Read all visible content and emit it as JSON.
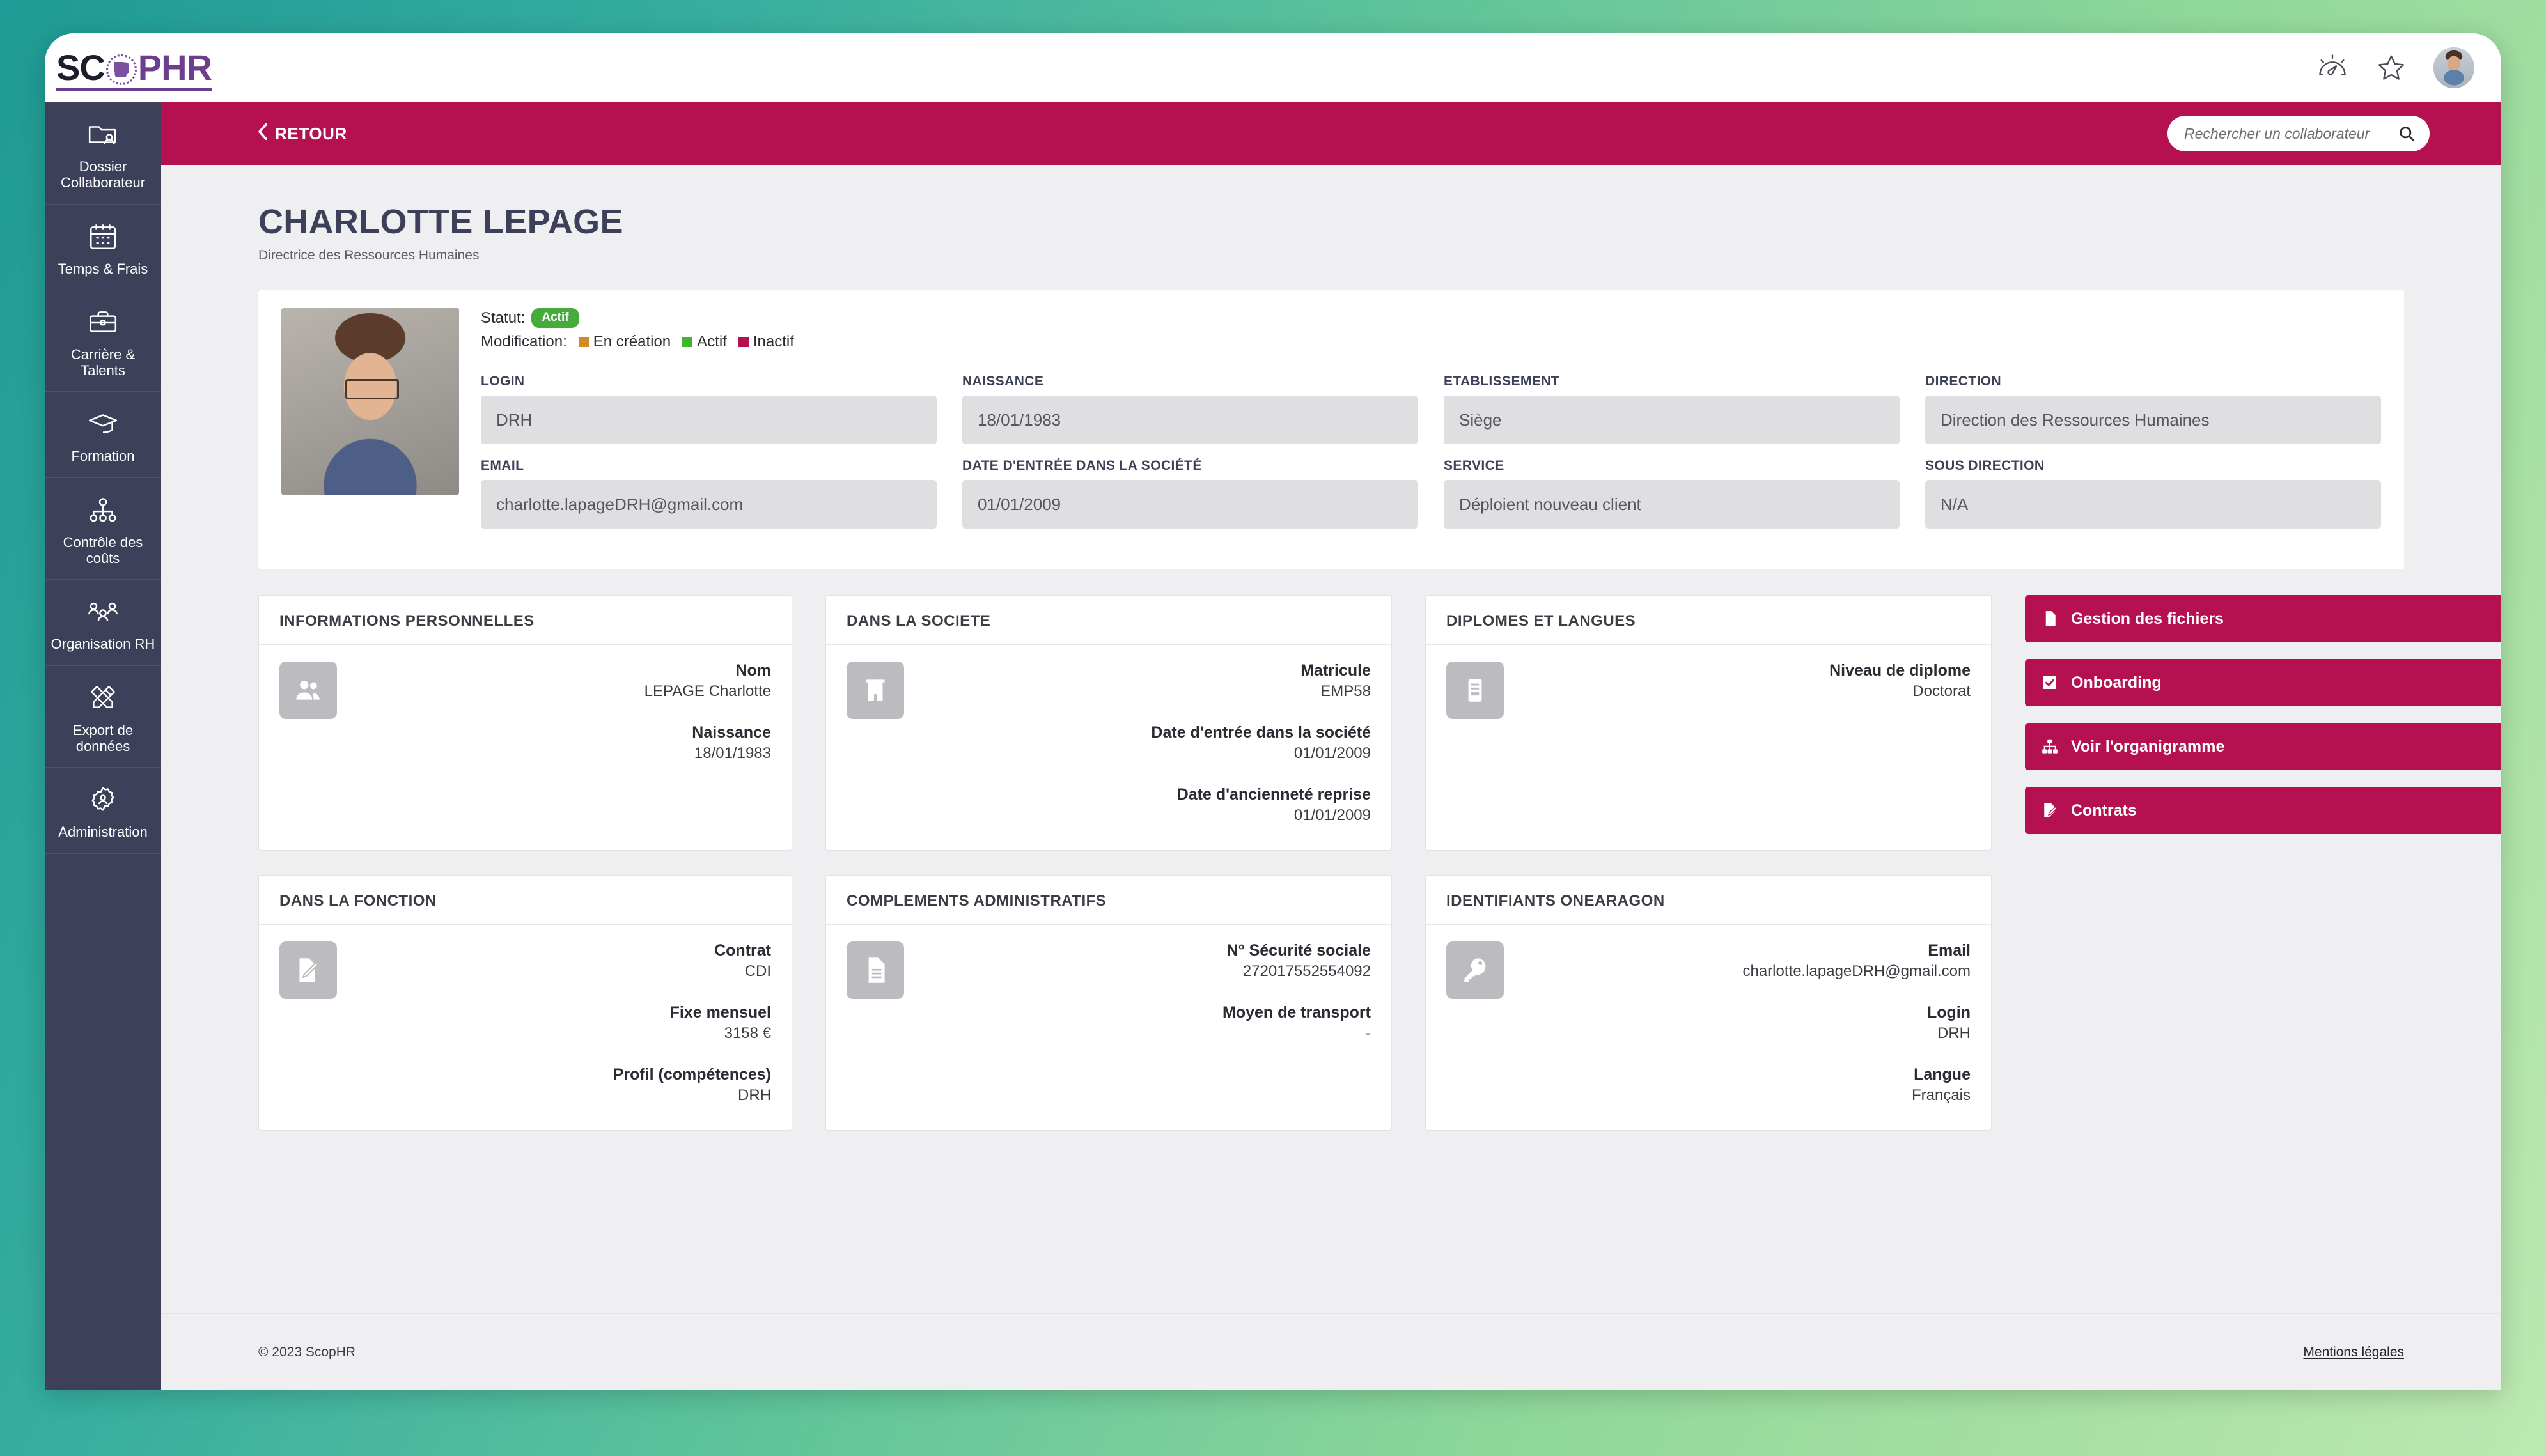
{
  "brand": {
    "part1": "SC",
    "icon": "hr-network-icon",
    "part2": "PHR"
  },
  "topbar": {
    "dashboard_icon": "gauge-icon",
    "favorite_icon": "star-icon",
    "avatar": "user-avatar"
  },
  "sidebar": {
    "items": [
      {
        "label": "Dossier Collaborateur",
        "icon": "folder-user-icon"
      },
      {
        "label": "Temps & Frais",
        "icon": "calendar-icon"
      },
      {
        "label": "Carrière & Talents",
        "icon": "briefcase-icon"
      },
      {
        "label": "Formation",
        "icon": "graduation-cap-icon"
      },
      {
        "label": "Contrôle des coûts",
        "icon": "hierarchy-icon"
      },
      {
        "label": "Organisation RH",
        "icon": "people-group-icon"
      },
      {
        "label": "Export de données",
        "icon": "pencil-ruler-icon"
      },
      {
        "label": "Administration",
        "icon": "gear-user-icon"
      }
    ]
  },
  "header": {
    "back_label": "RETOUR",
    "back_icon": "chevron-left-icon",
    "search_placeholder": "Rechercher un collaborateur",
    "search_value": "",
    "search_icon": "search-icon"
  },
  "employee": {
    "name": "CHARLOTTE LEPAGE",
    "job_title": "Directrice des Ressources Humaines",
    "status_label": "Statut:",
    "status_value": "Actif",
    "modification_label": "Modification:",
    "legend": [
      {
        "label": "En création",
        "color": "#d08b26"
      },
      {
        "label": "Actif",
        "color": "#3eb52c"
      },
      {
        "label": "Inactif",
        "color": "#b51050"
      }
    ]
  },
  "fields": [
    {
      "label": "LOGIN",
      "value": "DRH"
    },
    {
      "label": "NAISSANCE",
      "value": "18/01/1983"
    },
    {
      "label": "ETABLISSEMENT",
      "value": "Siège"
    },
    {
      "label": "DIRECTION",
      "value": "Direction des Ressources Humaines"
    },
    {
      "label": "EMAIL",
      "value": "charlotte.lapageDRH@gmail.com"
    },
    {
      "label": "DATE D'ENTRÉE DANS LA SOCIÉTÉ",
      "value": "01/01/2009"
    },
    {
      "label": "SERVICE",
      "value": "Déploient nouveau client"
    },
    {
      "label": "SOUS DIRECTION",
      "value": "N/A"
    }
  ],
  "cards": [
    {
      "title": "INFORMATIONS PERSONNELLES",
      "icon": "people-icon",
      "rows": [
        {
          "label": "Nom",
          "value": "LEPAGE Charlotte"
        },
        {
          "label": "Naissance",
          "value": "18/01/1983"
        }
      ]
    },
    {
      "title": "DANS LA SOCIETE",
      "icon": "building-icon",
      "rows": [
        {
          "label": "Matricule",
          "value": "EMP58"
        },
        {
          "label": "Date d'entrée dans la société",
          "value": "01/01/2009"
        },
        {
          "label": "Date d'ancienneté reprise",
          "value": "01/01/2009"
        }
      ]
    },
    {
      "title": "DIPLOMES ET LANGUES",
      "icon": "certificate-icon",
      "rows": [
        {
          "label": "Niveau de diplome",
          "value": "Doctorat"
        }
      ]
    },
    {
      "title": "DANS LA FONCTION",
      "icon": "contract-edit-icon",
      "rows": [
        {
          "label": "Contrat",
          "value": "CDI"
        },
        {
          "label": "Fixe mensuel",
          "value": "3158 €"
        },
        {
          "label": "Profil (compétences)",
          "value": "DRH"
        }
      ]
    },
    {
      "title": "COMPLEMENTS ADMINISTRATIFS",
      "icon": "document-icon",
      "rows": [
        {
          "label": "N° Sécurité sociale",
          "value": "272017552554092"
        },
        {
          "label": "Moyen de transport",
          "value": "-"
        }
      ]
    },
    {
      "title": "IDENTIFIANTS ONEARAGON",
      "icon": "key-icon",
      "rows": [
        {
          "label": "Email",
          "value": "charlotte.lapageDRH@gmail.com"
        },
        {
          "label": "Login",
          "value": "DRH"
        },
        {
          "label": "Langue",
          "value": "Français"
        }
      ]
    }
  ],
  "actions": [
    {
      "label": "Gestion des fichiers",
      "icon": "file-icon"
    },
    {
      "label": "Onboarding",
      "icon": "checkbox-icon"
    },
    {
      "label": "Voir l'organigramme",
      "icon": "org-chart-icon"
    },
    {
      "label": "Contrats",
      "icon": "contract-icon"
    }
  ],
  "footer": {
    "copyright": "© 2023 ScopHR",
    "legal": "Mentions légales"
  },
  "colors": {
    "accent": "#b51050",
    "sidebar": "#3d4059",
    "status_active": "#46ab3a",
    "brand_purple": "#6b3f8e"
  }
}
